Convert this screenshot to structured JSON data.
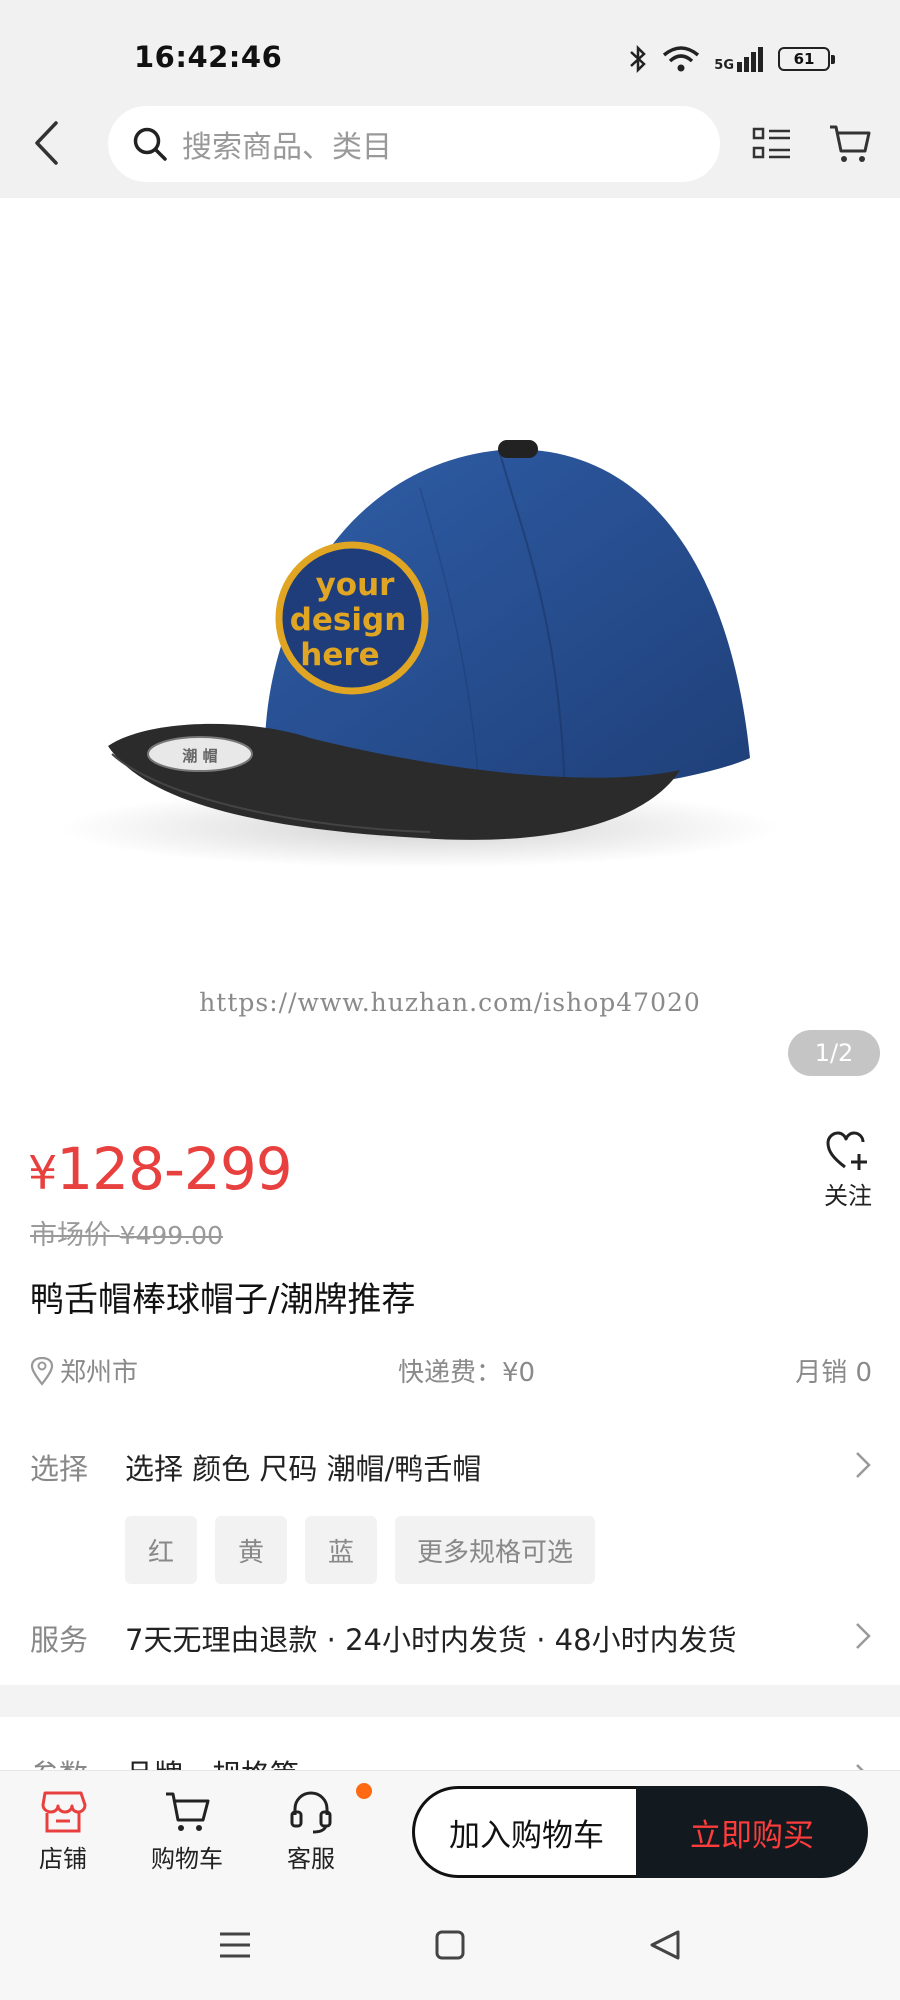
{
  "status_bar": {
    "time": "16:42:46",
    "battery": "61",
    "network": "5G"
  },
  "search": {
    "placeholder": "搜索商品、类目"
  },
  "gallery": {
    "image_name": "baseball-cap-mockup",
    "cap_patch_lines": [
      "your",
      "design",
      "here"
    ],
    "watermark": "https://www.huzhan.com/ishop47020",
    "counter": "1/2"
  },
  "product": {
    "price_symbol": "¥",
    "price_range": "128-299",
    "market_price_label": "市场价",
    "market_price": "¥499.00",
    "follow_label": "关注",
    "title": "鸭舌帽棒球帽子/潮牌推荐",
    "location": "郑州市",
    "shipping": "快递费：¥0",
    "monthly_sales": "月销 0"
  },
  "select": {
    "label": "选择",
    "value": "选择 颜色  尺码  潮帽/鸭舌帽",
    "chips": [
      "红",
      "黄",
      "蓝",
      "更多规格可选"
    ]
  },
  "service": {
    "label": "服务",
    "value": "7天无理由退款 · 24小时内发货 · 48小时内发货"
  },
  "params": {
    "label": "参数",
    "value": "品牌、规格等"
  },
  "action_bar": {
    "shop_label": "店铺",
    "cart_label": "购物车",
    "service_label": "客服",
    "add_cart_label": "加入购物车",
    "buy_label": "立即购买"
  },
  "colors": {
    "price": "#e8403f",
    "buy_text": "#ff3c3c",
    "buy_bg": "#121a1f",
    "badge": "#ff6a13",
    "shop_icon": "#e8403f"
  }
}
